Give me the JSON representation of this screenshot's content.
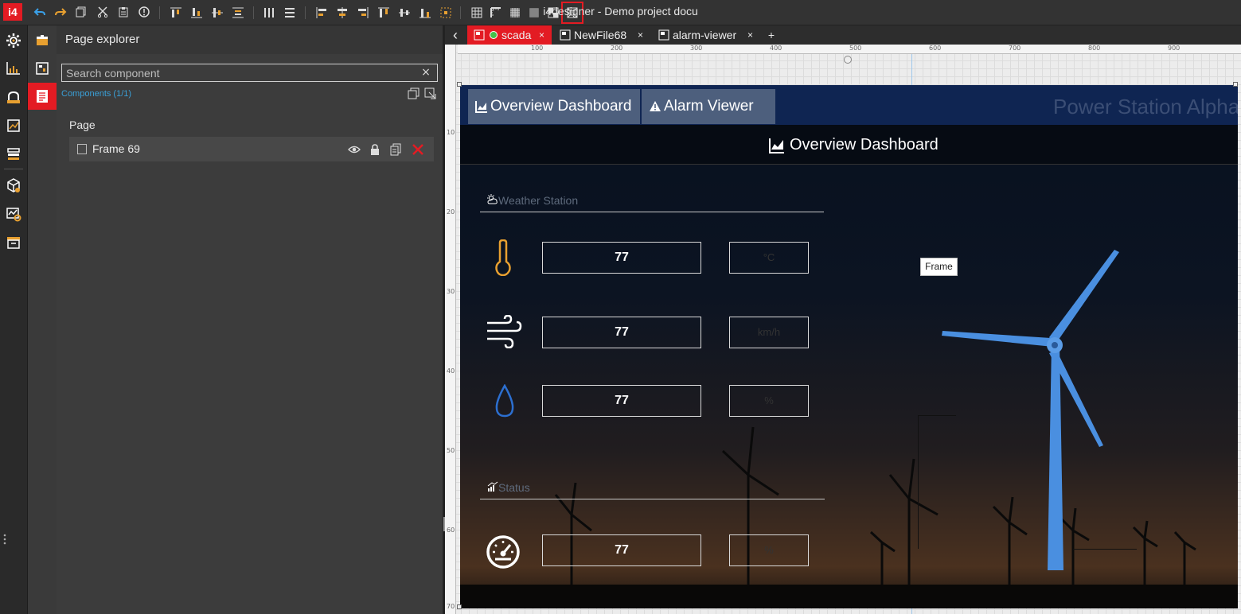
{
  "app": {
    "logo_text": "i4",
    "window_title": "i4designer - Demo project docu"
  },
  "toolbar": {
    "icons": [
      "undo-icon",
      "redo-icon",
      "copy-icon",
      "cut-icon",
      "paste-icon",
      "info-icon",
      "align-top-icon",
      "align-bottom-icon",
      "align-middle-icon",
      "align-distribute-icon",
      "columns-icon",
      "rows-icon",
      "align-left-icon",
      "align-center-icon",
      "align-right-icon",
      "align-top2-icon",
      "align-middle2-icon",
      "align-bottom2-icon",
      "snap-icon",
      "grid-icon",
      "ruler-icon",
      "grid-dense-icon",
      "grid-fine-icon",
      "grid-toggle-icon",
      "frame-select-icon"
    ]
  },
  "leftbar": {
    "icons": [
      "settings-icon",
      "dashboard-icon",
      "toolbox-icon",
      "widgets-icon",
      "layers-icon",
      "package-icon",
      "config-icon",
      "archive-icon"
    ]
  },
  "leftbar2": {
    "icons": [
      "toolbox-icon",
      "component-icon",
      "page-explorer-icon"
    ]
  },
  "explorer": {
    "title": "Page explorer",
    "search_placeholder": "Search component",
    "components_count": "Components (1/1)",
    "page_label": "Page",
    "items": [
      {
        "label": "Frame 69"
      }
    ]
  },
  "tabs": [
    {
      "label": "scada",
      "status_color": "#44c04a",
      "active": true
    },
    {
      "label": "NewFile68",
      "active": false
    },
    {
      "label": "alarm-viewer",
      "active": false
    }
  ],
  "tabs_extra": {
    "back": "‹",
    "add": "+",
    "close": "×"
  },
  "ruler": {
    "h_labels": [
      "100",
      "200",
      "300",
      "400",
      "500",
      "600",
      "700",
      "800",
      "900"
    ],
    "v_labels": [
      "10",
      "20",
      "30",
      "40",
      "50",
      "60",
      "70"
    ]
  },
  "canvas": {
    "nav": [
      {
        "label": "Overview Dashboard",
        "icon": "chart-icon"
      },
      {
        "label": "Alarm Viewer",
        "icon": "warning-icon"
      }
    ],
    "station_title": "Power Station Alpha",
    "main_title": "Overview Dashboard",
    "sections": [
      {
        "title": "Weather Station",
        "icon": "weather-icon"
      },
      {
        "title": "Status",
        "icon": "status-icon"
      }
    ],
    "readings": [
      {
        "value": "77",
        "unit": "°C",
        "icon": "thermometer-icon",
        "icon_color": "#e8a030"
      },
      {
        "value": "77",
        "unit": "km/h",
        "icon": "wind-icon",
        "icon_color": "#ffffff"
      },
      {
        "value": "77",
        "unit": "%",
        "icon": "droplet-icon",
        "icon_color": "#2c6fd0"
      },
      {
        "value": "77",
        "unit": "%",
        "icon": "gauge-icon",
        "icon_color": "#ffffff"
      }
    ],
    "turbine_color": "#4a8fe0",
    "tooltip": "Frame"
  }
}
